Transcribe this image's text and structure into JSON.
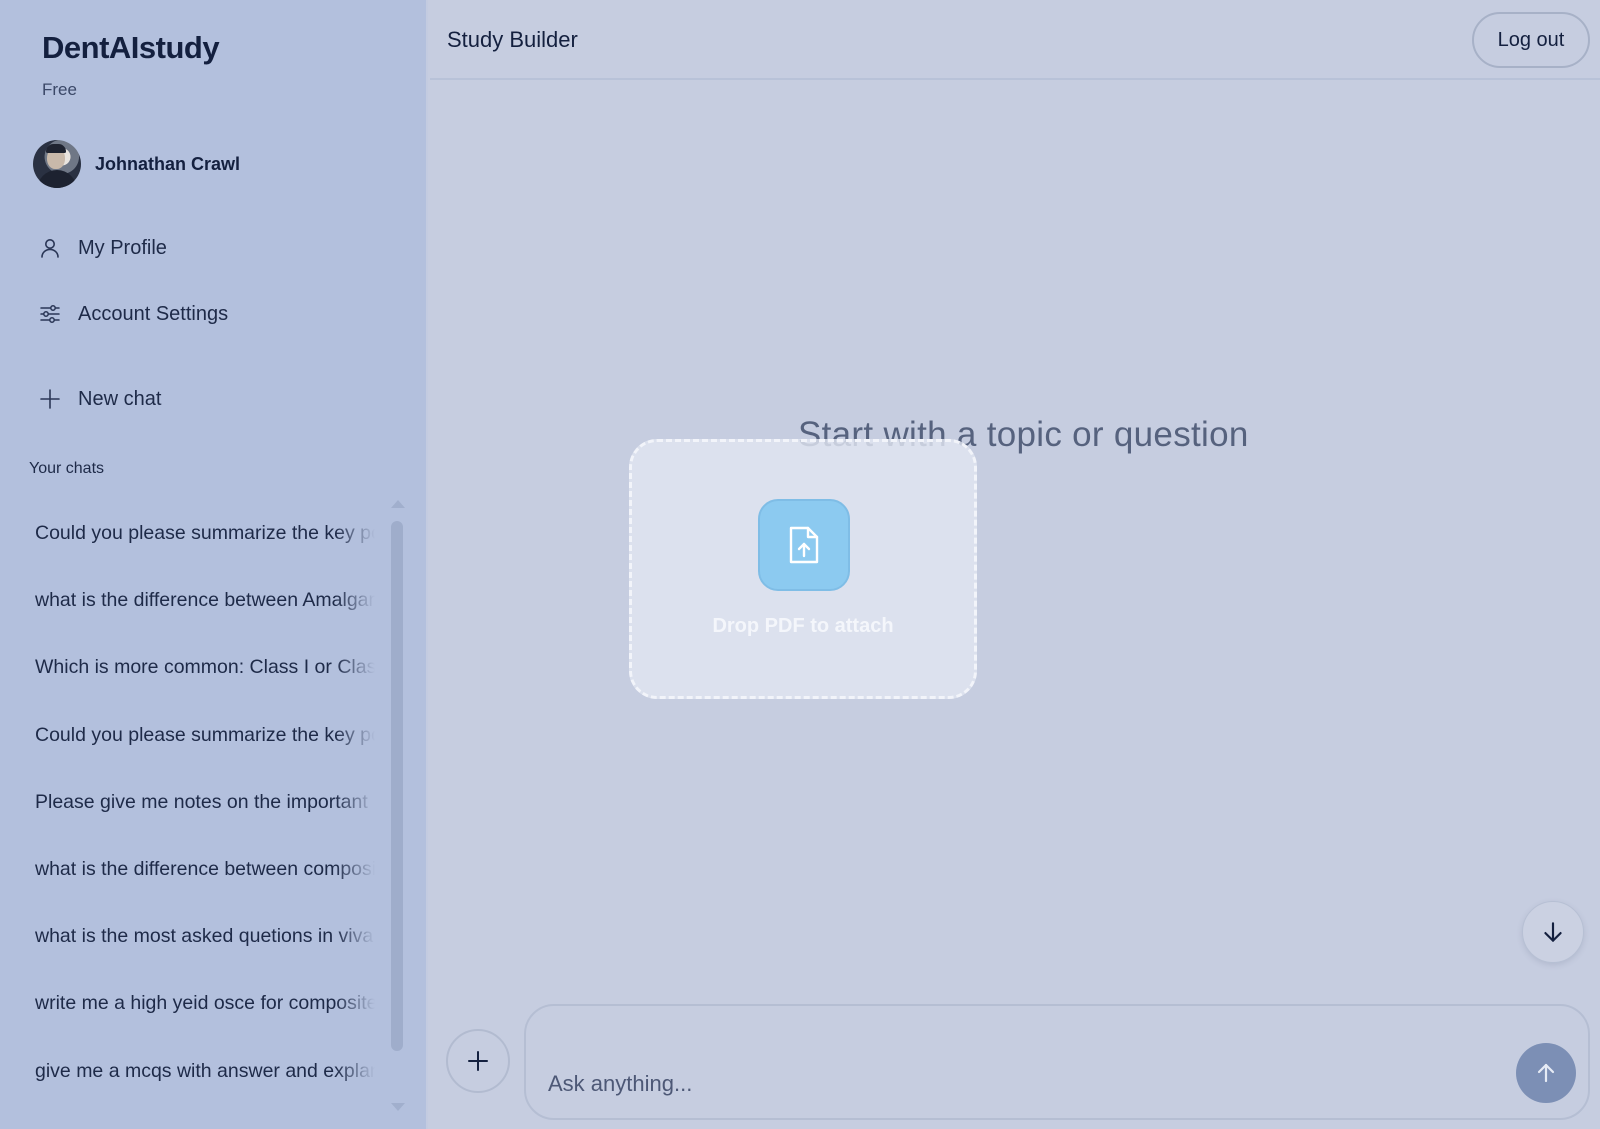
{
  "sidebar": {
    "brand": "DentAIstudy",
    "plan": "Free",
    "user": {
      "name": "Johnathan Crawl",
      "avatar_icon": "user-photo"
    },
    "nav": [
      {
        "label": "My Profile",
        "icon": "person-icon"
      },
      {
        "label": "Account Settings",
        "icon": "sliders-icon"
      },
      {
        "label": "New chat",
        "icon": "plus-icon"
      }
    ],
    "chats_title": "Your chats",
    "chats": [
      "Could you please summarize the key points",
      "what is the difference between Amalgam",
      "Which is more common: Class I or Class",
      "Could you please summarize the key points",
      "Please give me notes on the important",
      "what is the difference between composite",
      "what is the most asked quetions in viva",
      "write me a high yeid osce for composite",
      "give me a mcqs with answer and explanation"
    ]
  },
  "header": {
    "title": "Study Builder",
    "logout_label": "Log out"
  },
  "main": {
    "prompt": "Start with a topic or question",
    "dropzone_label": "Drop PDF to attach",
    "dropzone_icon": "file-upload-icon"
  },
  "composer": {
    "placeholder": "Ask anything...",
    "value": "",
    "attach_icon": "plus-icon",
    "send_icon": "arrow-up-icon",
    "scroll_icon": "arrow-down-icon"
  },
  "colors": {
    "background": "#c6cde0",
    "sidebar": "#b3c0dd",
    "accent": "#8ccaf0",
    "send_button": "#7c8fb5",
    "text": "#1e2a48"
  }
}
